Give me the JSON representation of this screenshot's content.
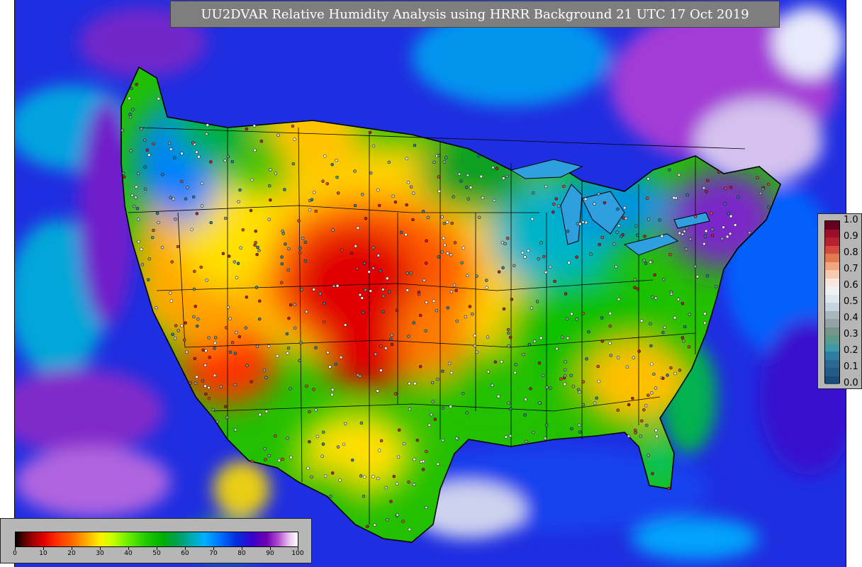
{
  "title": "UU2DVAR Relative Humidity Analysis using HRRR Background 21 UTC 17 Oct 2019",
  "colors": {
    "ocean_background": "#1f2ee0",
    "map_outline": "#000000",
    "title_background": "#7e7e7e",
    "legend_background": "#b6b6b6"
  },
  "humidity_legend": {
    "ticks": [
      "0",
      "10",
      "20",
      "30",
      "40",
      "50",
      "60",
      "70",
      "80",
      "90",
      "100"
    ]
  },
  "observation_legend": {
    "ticks": [
      "1.0",
      "0.9",
      "0.8",
      "0.7",
      "0.6",
      "0.5",
      "0.4",
      "0.3",
      "0.2",
      "0.1",
      "0.0"
    ],
    "swatch_colors": [
      "#67001f",
      "#9a1028",
      "#b8202f",
      "#d24a3d",
      "#e3794f",
      "#f2a57f",
      "#f7c9ae",
      "#f7e6df",
      "#f0f0f0",
      "#dbe6ef",
      "#c4d5e0",
      "#aab6bc",
      "#93a3a8",
      "#77958a",
      "#5c9a8e",
      "#3f9aa8",
      "#2d7ea0",
      "#2a6a92",
      "#215b86",
      "#1a4a76"
    ]
  }
}
